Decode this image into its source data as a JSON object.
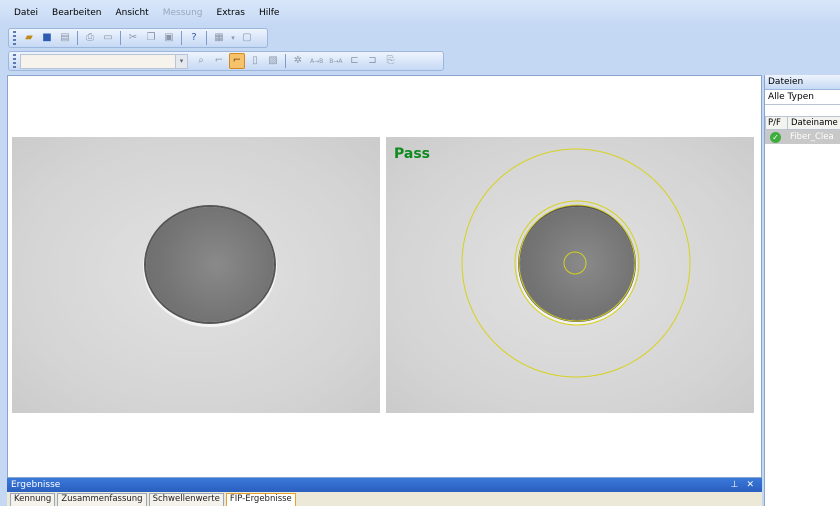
{
  "menu": {
    "items": [
      {
        "label": "Datei",
        "enabled": true
      },
      {
        "label": "Bearbeiten",
        "enabled": true
      },
      {
        "label": "Ansicht",
        "enabled": true
      },
      {
        "label": "Messung",
        "enabled": false
      },
      {
        "label": "Extras",
        "enabled": true
      },
      {
        "label": "Hilfe",
        "enabled": true
      }
    ]
  },
  "toolbar2": {
    "combo_value": "",
    "ab_label": "A→B",
    "ba_label": "B→A"
  },
  "image": {
    "result_label": "Pass",
    "result_color": "#0e8a1e",
    "overlay_color": "#d6d21e"
  },
  "results": {
    "title": "Ergebnisse",
    "pin_icon": "pin-icon",
    "close_icon": "close-icon",
    "tabs": [
      {
        "label": "Kennung",
        "active": false
      },
      {
        "label": "Zusammenfassung",
        "active": false
      },
      {
        "label": "Schwellenwerte",
        "active": false
      },
      {
        "label": "FIP-Ergebnisse",
        "active": true
      }
    ]
  },
  "files": {
    "title": "Dateien",
    "filter": "Alle Typen",
    "columns": {
      "pf": "P/F",
      "name": "Dateiname"
    },
    "rows": [
      {
        "status": "pass",
        "name": "Fiber_Clea"
      }
    ]
  }
}
